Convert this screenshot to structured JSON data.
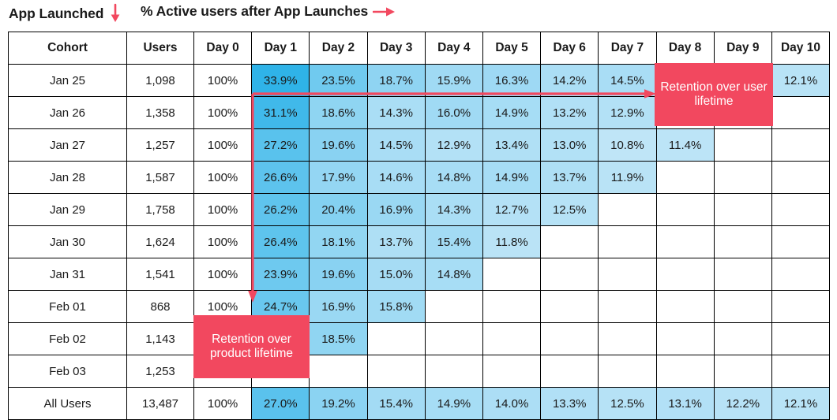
{
  "annotations": {
    "app_launched": "App Launched",
    "app_launched_icon": "arrow-down-icon",
    "active_users": "% Active users after App Launches",
    "active_users_icon": "arrow-right-icon"
  },
  "callouts": {
    "user_lifetime": "Retention over user lifetime",
    "product_lifetime": "Retention over product lifetime"
  },
  "colors": {
    "accent_red": "#f2485f",
    "day0_navy": "#123f66",
    "grid_black": "#000000",
    "blue_high": "#2eb2e8",
    "blue_low": "#bfe5f7"
  },
  "chart_data": {
    "type": "table",
    "title": "% Active users after App Launches",
    "columns": [
      "Cohort",
      "Users",
      "Day 0",
      "Day 1",
      "Day 2",
      "Day 3",
      "Day 4",
      "Day 5",
      "Day 6",
      "Day 7",
      "Day 8",
      "Day 9",
      "Day 10"
    ],
    "categories": [
      "Jan 25",
      "Jan 26",
      "Jan 27",
      "Jan 28",
      "Jan 29",
      "Jan 30",
      "Jan 31",
      "Feb 01",
      "Feb 02",
      "Feb 03",
      "All Users"
    ],
    "rows": [
      {
        "cohort": "Jan 25",
        "users": "1,098",
        "values": [
          "100%",
          "33.9%",
          "23.5%",
          "18.7%",
          "15.9%",
          "16.3%",
          "14.2%",
          "14.5%",
          "",
          "",
          "12.1%"
        ],
        "numeric": [
          100,
          33.9,
          23.5,
          18.7,
          15.9,
          16.3,
          14.2,
          14.5,
          null,
          null,
          12.1
        ]
      },
      {
        "cohort": "Jan 26",
        "users": "1,358",
        "values": [
          "100%",
          "31.1%",
          "18.6%",
          "14.3%",
          "16.0%",
          "14.9%",
          "13.2%",
          "12.9%",
          "",
          "",
          ""
        ],
        "numeric": [
          100,
          31.1,
          18.6,
          14.3,
          16.0,
          14.9,
          13.2,
          12.9,
          null,
          null,
          null
        ]
      },
      {
        "cohort": "Jan 27",
        "users": "1,257",
        "values": [
          "100%",
          "27.2%",
          "19.6%",
          "14.5%",
          "12.9%",
          "13.4%",
          "13.0%",
          "10.8%",
          "11.4%",
          "",
          ""
        ],
        "numeric": [
          100,
          27.2,
          19.6,
          14.5,
          12.9,
          13.4,
          13.0,
          10.8,
          11.4,
          null,
          null
        ]
      },
      {
        "cohort": "Jan 28",
        "users": "1,587",
        "values": [
          "100%",
          "26.6%",
          "17.9%",
          "14.6%",
          "14.8%",
          "14.9%",
          "13.7%",
          "11.9%",
          "",
          "",
          ""
        ],
        "numeric": [
          100,
          26.6,
          17.9,
          14.6,
          14.8,
          14.9,
          13.7,
          11.9,
          null,
          null,
          null
        ]
      },
      {
        "cohort": "Jan 29",
        "users": "1,758",
        "values": [
          "100%",
          "26.2%",
          "20.4%",
          "16.9%",
          "14.3%",
          "12.7%",
          "12.5%",
          "",
          "",
          "",
          ""
        ],
        "numeric": [
          100,
          26.2,
          20.4,
          16.9,
          14.3,
          12.7,
          12.5,
          null,
          null,
          null,
          null
        ]
      },
      {
        "cohort": "Jan 30",
        "users": "1,624",
        "values": [
          "100%",
          "26.4%",
          "18.1%",
          "13.7%",
          "15.4%",
          "11.8%",
          "",
          "",
          "",
          "",
          ""
        ],
        "numeric": [
          100,
          26.4,
          18.1,
          13.7,
          15.4,
          11.8,
          null,
          null,
          null,
          null,
          null
        ]
      },
      {
        "cohort": "Jan 31",
        "users": "1,541",
        "values": [
          "100%",
          "23.9%",
          "19.6%",
          "15.0%",
          "14.8%",
          "",
          "",
          "",
          "",
          "",
          ""
        ],
        "numeric": [
          100,
          23.9,
          19.6,
          15.0,
          14.8,
          null,
          null,
          null,
          null,
          null,
          null
        ]
      },
      {
        "cohort": "Feb 01",
        "users": "868",
        "values": [
          "100%",
          "24.7%",
          "16.9%",
          "15.8%",
          "",
          "",
          "",
          "",
          "",
          "",
          ""
        ],
        "numeric": [
          100,
          24.7,
          16.9,
          15.8,
          null,
          null,
          null,
          null,
          null,
          null,
          null
        ]
      },
      {
        "cohort": "Feb 02",
        "users": "1,143",
        "values": [
          "",
          "",
          "18.5%",
          "",
          "",
          "",
          "",
          "",
          "",
          "",
          ""
        ],
        "numeric": [
          null,
          null,
          18.5,
          null,
          null,
          null,
          null,
          null,
          null,
          null,
          null
        ]
      },
      {
        "cohort": "Feb 03",
        "users": "1,253",
        "values": [
          "",
          "",
          "",
          "",
          "",
          "",
          "",
          "",
          "",
          "",
          ""
        ],
        "numeric": [
          null,
          null,
          null,
          null,
          null,
          null,
          null,
          null,
          null,
          null,
          null
        ]
      },
      {
        "cohort": "All Users",
        "users": "13,487",
        "total": true,
        "values": [
          "100%",
          "27.0%",
          "19.2%",
          "15.4%",
          "14.9%",
          "14.0%",
          "13.3%",
          "12.5%",
          "13.1%",
          "12.2%",
          "12.1%"
        ],
        "numeric": [
          100,
          27.0,
          19.2,
          15.4,
          14.9,
          14.0,
          13.3,
          12.5,
          13.1,
          12.2,
          12.1
        ]
      }
    ]
  }
}
